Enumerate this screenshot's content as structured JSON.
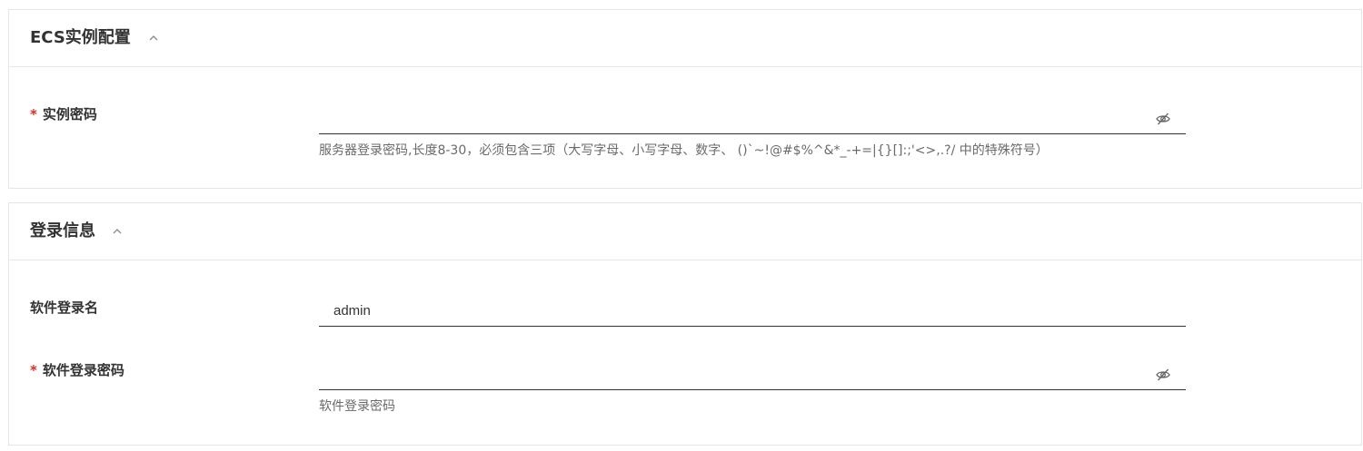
{
  "sections": {
    "ecs": {
      "title": "ECS实例配置",
      "collapse_icon": "chevron-up-icon",
      "password_field": {
        "required_mark": "*",
        "label": "实例密码",
        "value": "",
        "visibility_icon": "eye-off-icon",
        "help": "服务器登录密码,长度8-30，必须包含三项（大写字母、小写字母、数字、 ()`~!@#$%^&*_-+=|{}[]:;'<>,.?/ 中的特殊符号）"
      }
    },
    "login": {
      "title": "登录信息",
      "collapse_icon": "chevron-up-icon",
      "username_field": {
        "label": "软件登录名",
        "value": "admin"
      },
      "password_field": {
        "required_mark": "*",
        "label": "软件登录密码",
        "value": "",
        "visibility_icon": "eye-off-icon",
        "help": "软件登录密码"
      }
    }
  },
  "colors": {
    "required": "#d93026",
    "border": "#e5e5e5",
    "input_underline": "#333333",
    "help_text": "#6a6a6a"
  }
}
